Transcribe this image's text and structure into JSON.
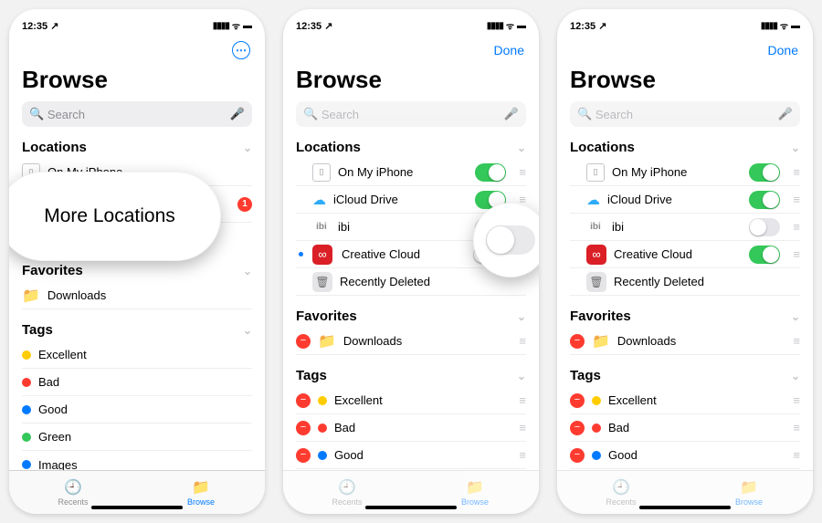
{
  "status": {
    "time": "12:35",
    "loc_arrow": "➤"
  },
  "nav": {
    "done": "Done",
    "more": "⋯"
  },
  "title": "Browse",
  "search": {
    "placeholder": "Search"
  },
  "sections": {
    "locations": "Locations",
    "favorites": "Favorites",
    "tags": "Tags"
  },
  "locations": {
    "iphone": "On My iPhone",
    "icloud": "iCloud Drive",
    "ibi": "ibi",
    "cc": "Creative Cloud",
    "deleted": "Recently Deleted"
  },
  "more_locations": {
    "label": "More Locations",
    "badge": "1"
  },
  "favorites": {
    "downloads": "Downloads"
  },
  "tags": {
    "excellent": "Excellent",
    "bad": "Bad",
    "good": "Good",
    "green": "Green",
    "images": "Images"
  },
  "tag_colors": {
    "excellent": "#ffcc00",
    "bad": "#ff3b30",
    "good": "#007aff",
    "green": "#34c759",
    "images": "#007aff"
  },
  "tabs": {
    "recents": "Recents",
    "browse": "Browse"
  }
}
